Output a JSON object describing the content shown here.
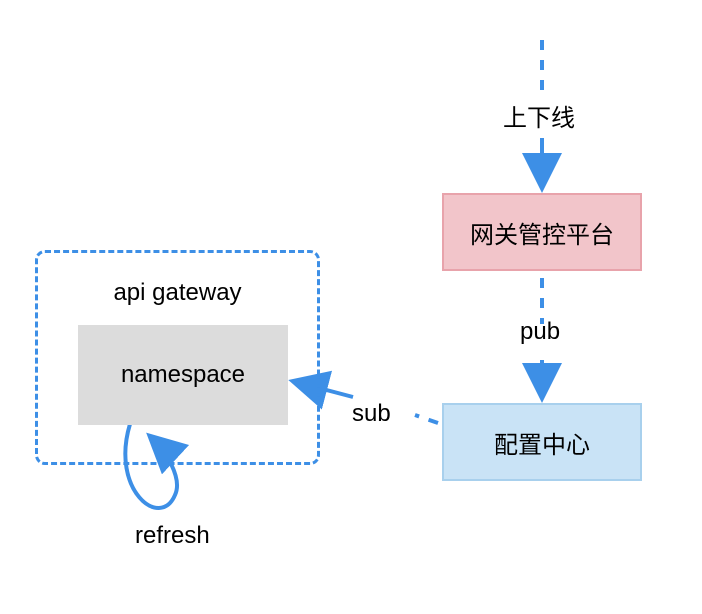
{
  "diagram": {
    "container": {
      "title": "api gateway",
      "inner_box": "namespace"
    },
    "boxes": {
      "management": "网关管控平台",
      "config_center": "配置中心"
    },
    "labels": {
      "online_offline": "上下线",
      "pub": "pub",
      "sub": "sub",
      "refresh": "refresh"
    },
    "colors": {
      "arrow": "#3d8fe6",
      "dashed_border": "#3d8fe6",
      "mgmt_bg": "#f2c5ca",
      "config_bg": "#c9e3f6",
      "namespace_bg": "#dcdcdc"
    }
  }
}
